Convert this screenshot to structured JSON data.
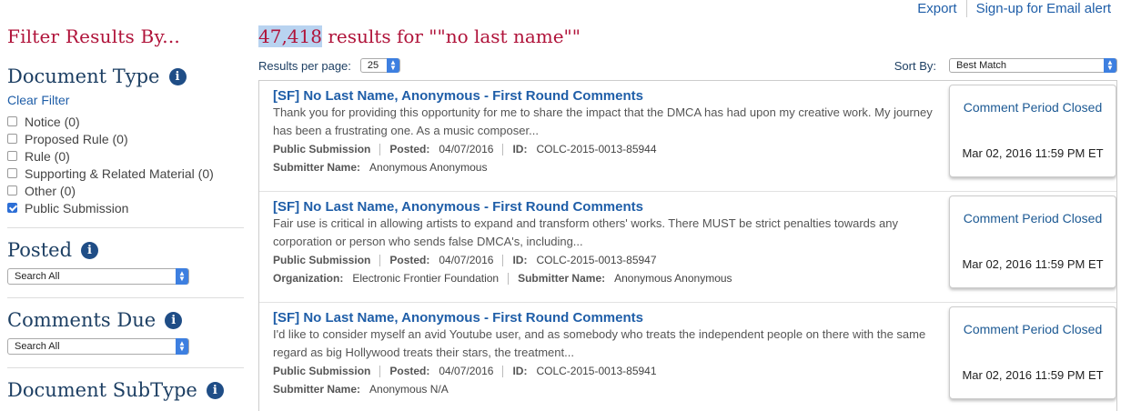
{
  "top_links": {
    "export": "Export",
    "signup": "Sign-up for Email alert"
  },
  "sidebar": {
    "filter_title": "Filter Results By...",
    "document_type": {
      "title": "Document Type",
      "clear_filter": "Clear Filter",
      "options": [
        {
          "label": "Notice (0)",
          "checked": false
        },
        {
          "label": "Proposed Rule (0)",
          "checked": false
        },
        {
          "label": "Rule (0)",
          "checked": false
        },
        {
          "label": "Supporting & Related Material (0)",
          "checked": false
        },
        {
          "label": "Other (0)",
          "checked": false
        },
        {
          "label": "Public Submission",
          "checked": true
        }
      ]
    },
    "posted": {
      "title": "Posted",
      "select_value": "Search All"
    },
    "comments_due": {
      "title": "Comments Due",
      "select_value": "Search All"
    },
    "document_subtype": {
      "title": "Document SubType"
    }
  },
  "main": {
    "results_count": "47,418",
    "results_text": " results for \"\"no last name\"\"",
    "results_per_page_label": "Results per page:",
    "results_per_page_value": "25",
    "sort_by_label": "Sort By:",
    "sort_by_value": "Best Match"
  },
  "results": [
    {
      "title": "[SF] No Last Name, Anonymous - First Round Comments",
      "snippet": "Thank you for providing this opportunity for me to share the impact that the DMCA has had upon my creative work. My journey has been a frustrating one. As a music composer...",
      "type": "Public Submission",
      "posted_label": "Posted:",
      "posted": "04/07/2016",
      "id_label": "ID:",
      "id": "COLC-2015-0013-85944",
      "line2": [
        {
          "label": "Submitter Name:",
          "value": "Anonymous Anonymous"
        }
      ],
      "status": "Comment Period Closed",
      "date": "Mar 02, 2016 11:59 PM ET"
    },
    {
      "title": "[SF] No Last Name, Anonymous - First Round Comments",
      "snippet": "Fair use is critical in allowing artists to expand and transform others' works. There MUST be strict penalties towards any corporation or person who sends false DMCA's, including...",
      "type": "Public Submission",
      "posted_label": "Posted:",
      "posted": "04/07/2016",
      "id_label": "ID:",
      "id": "COLC-2015-0013-85947",
      "line2": [
        {
          "label": "Organization:",
          "value": "Electronic Frontier Foundation"
        },
        {
          "label": "Submitter Name:",
          "value": "Anonymous Anonymous"
        }
      ],
      "status": "Comment Period Closed",
      "date": "Mar 02, 2016 11:59 PM ET"
    },
    {
      "title": "[SF] No Last Name, Anonymous - First Round Comments",
      "snippet": "I'd like to consider myself an avid Youtube user, and as somebody who treats the independent people on there with the same regard as big Hollywood treats their stars, the treatment...",
      "type": "Public Submission",
      "posted_label": "Posted:",
      "posted": "04/07/2016",
      "id_label": "ID:",
      "id": "COLC-2015-0013-85941",
      "line2": [
        {
          "label": "Submitter Name:",
          "value": "Anonymous N/A"
        }
      ],
      "status": "Comment Period Closed",
      "date": "Mar 02, 2016 11:59 PM ET"
    }
  ],
  "colors": {
    "heading_red": "#b0133a",
    "link_blue": "#1f5ea8",
    "navy": "#1d3f63",
    "highlight": "#b8d3f0"
  },
  "icons": {
    "info": "info-icon",
    "select_arrows": "chevron-updown-icon",
    "checkbox": "checkbox-icon"
  }
}
